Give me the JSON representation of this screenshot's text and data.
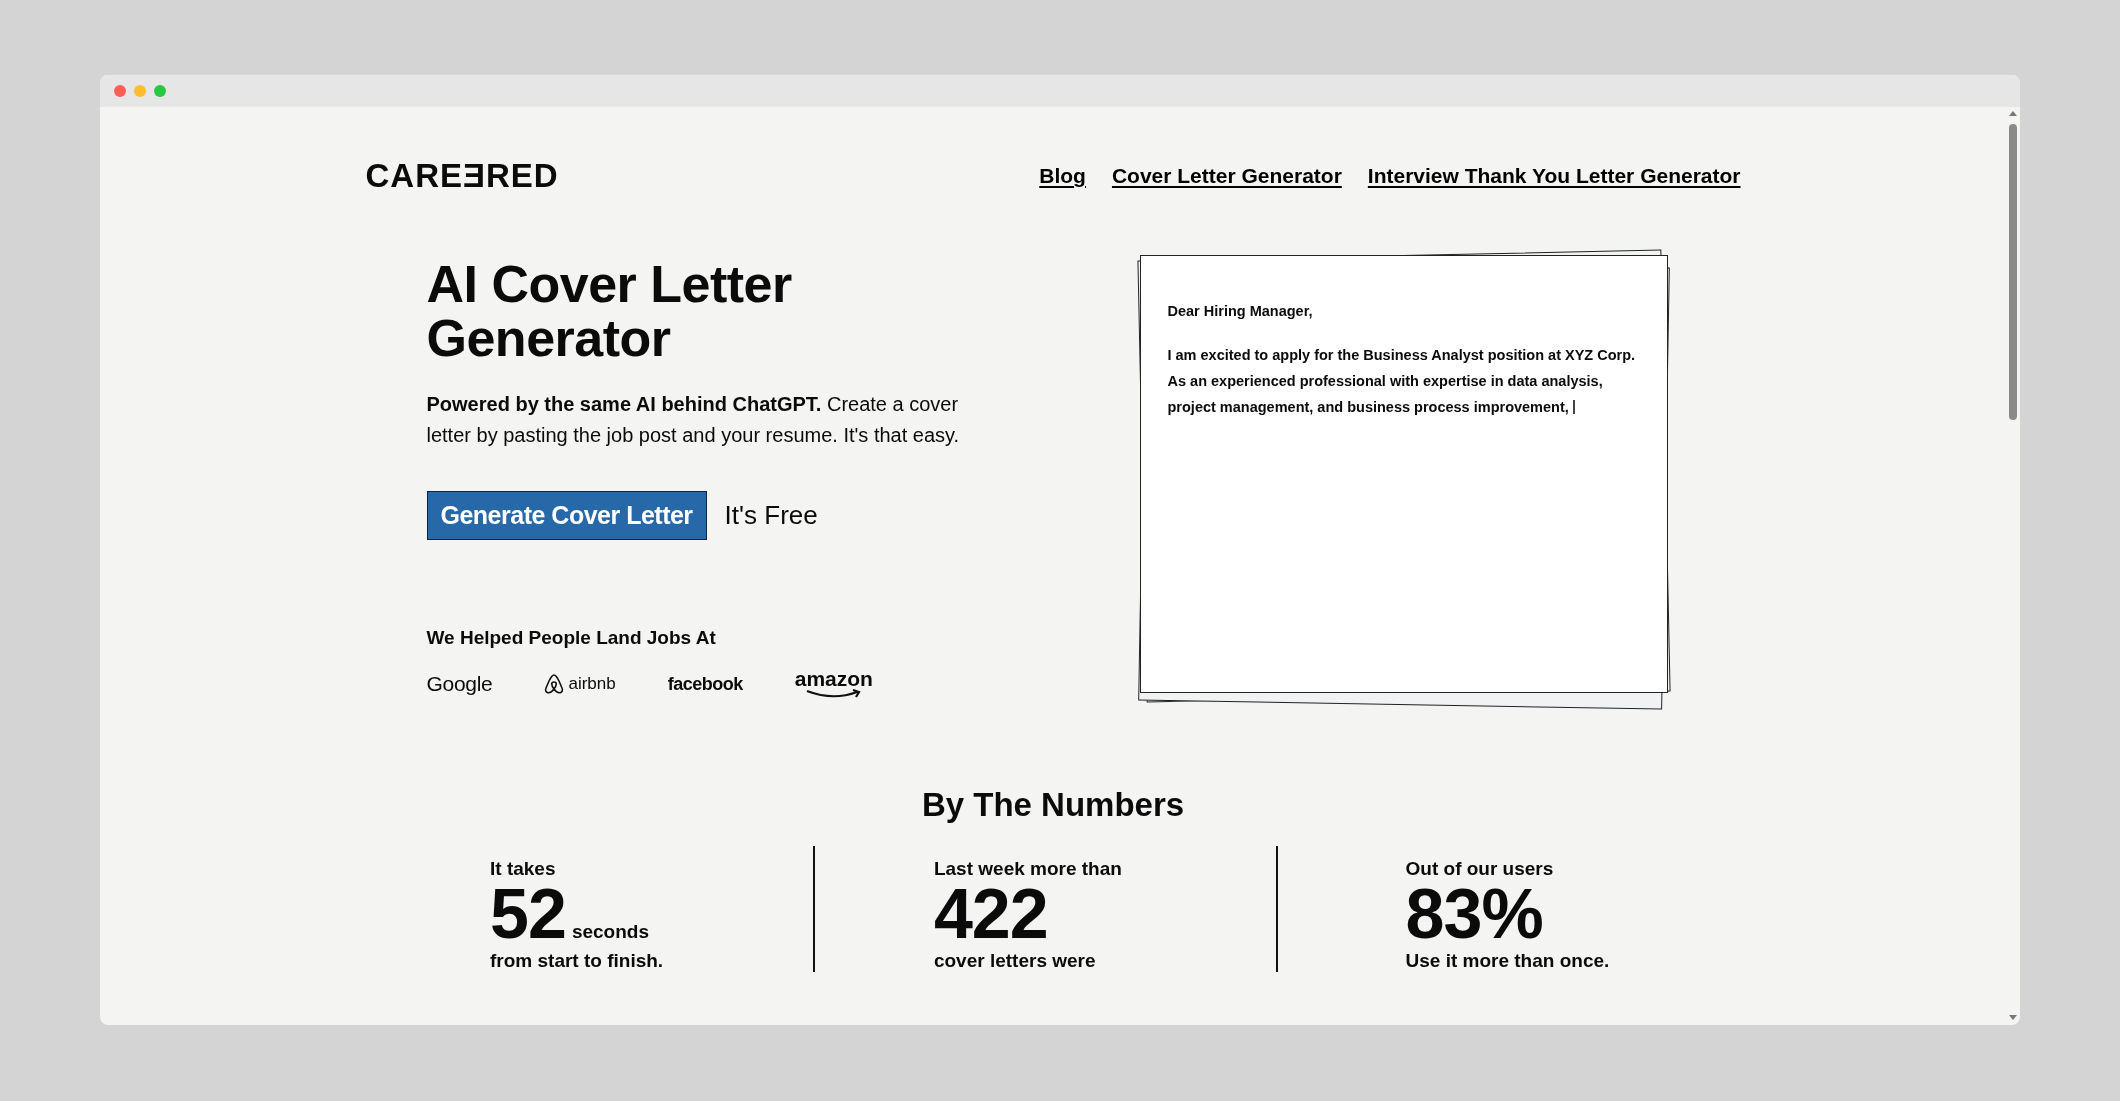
{
  "header": {
    "logo": "CAREƎRED",
    "nav": [
      {
        "label": "Blog"
      },
      {
        "label": "Cover Letter Generator"
      },
      {
        "label": "Interview Thank You Letter Generator"
      }
    ]
  },
  "hero": {
    "title_lines": [
      "AI Cover Letter",
      "Generator"
    ],
    "subtitle": "**Powered by the same AI behind ChatGPT.** Create a cover letter by pasting the job post and your resume. It's that easy.",
    "cta": "Generate Cover Letter",
    "cta_note": "It's Free",
    "companies_heading": "We Helped People Land Jobs At",
    "companies": [
      {
        "name": "Google",
        "kind": "plain"
      },
      {
        "name": "airbnb",
        "kind": "icon"
      },
      {
        "name": "facebook",
        "kind": "bold"
      },
      {
        "name": "amazon",
        "kind": "smile"
      }
    ]
  },
  "letter": {
    "greeting": "Dear Hiring Manager,",
    "body": "I am excited to apply for the Business Analyst position at XYZ Corp. As an experienced professional with expertise in data analysis, project management, and business process improvement,",
    "cursor": true
  },
  "numbers": {
    "heading": "By The Numbers",
    "stats": [
      {
        "lead": "It takes",
        "number": "52",
        "unit": "seconds",
        "tail": "from start to finish."
      },
      {
        "lead": "Last week more than",
        "number": "422",
        "tail": "cover letters were"
      },
      {
        "lead": "Out of our users",
        "number": "83%",
        "tail": "Use it more than once."
      }
    ]
  }
}
